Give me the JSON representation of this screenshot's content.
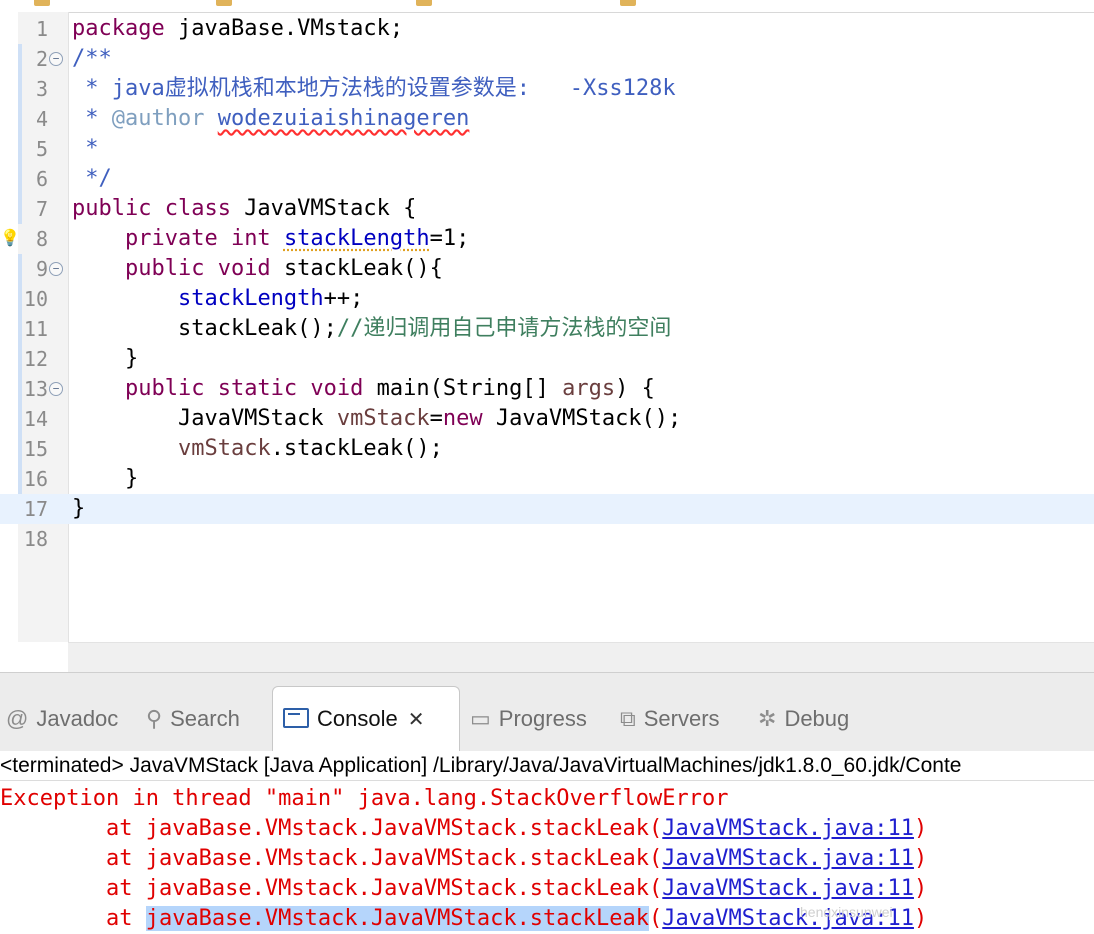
{
  "editor": {
    "lines": [
      {
        "n": "1",
        "segs": [
          {
            "c": "kw",
            "t": "package "
          },
          {
            "c": "",
            "t": "javaBase.VMstack;"
          }
        ]
      },
      {
        "n": "2",
        "fold": true,
        "segs": [
          {
            "c": "jd",
            "t": "/**"
          }
        ]
      },
      {
        "n": "3",
        "segs": [
          {
            "c": "jd",
            "t": " * java虚拟机栈和本地方法栈的设置参数是:   -Xss128k"
          }
        ]
      },
      {
        "n": "4",
        "segs": [
          {
            "c": "jd",
            "t": " * "
          },
          {
            "c": "tag",
            "t": "@author"
          },
          {
            "c": "jd",
            "t": " "
          },
          {
            "c": "spell",
            "t": "wodezuiaishinageren"
          }
        ]
      },
      {
        "n": "5",
        "segs": [
          {
            "c": "jd",
            "t": " *"
          }
        ]
      },
      {
        "n": "6",
        "segs": [
          {
            "c": "jd",
            "t": " */"
          }
        ]
      },
      {
        "n": "7",
        "segs": [
          {
            "c": "kw",
            "t": "public class "
          },
          {
            "c": "",
            "t": "JavaVMStack {"
          }
        ]
      },
      {
        "n": "8",
        "warn": true,
        "segs": [
          {
            "c": "",
            "t": "    "
          },
          {
            "c": "kw",
            "t": "private int "
          },
          {
            "c": "fld-warn",
            "t": "stackLength"
          },
          {
            "c": "",
            "t": "=1;"
          }
        ]
      },
      {
        "n": "9",
        "fold": true,
        "segs": [
          {
            "c": "",
            "t": "    "
          },
          {
            "c": "kw",
            "t": "public void "
          },
          {
            "c": "",
            "t": "stackLeak(){"
          }
        ]
      },
      {
        "n": "10",
        "segs": [
          {
            "c": "",
            "t": "        "
          },
          {
            "c": "fld",
            "t": "stackLength"
          },
          {
            "c": "",
            "t": "++;"
          }
        ]
      },
      {
        "n": "11",
        "segs": [
          {
            "c": "",
            "t": "        stackLeak();"
          },
          {
            "c": "cm",
            "t": "//递归调用自己申请方法栈的空间"
          }
        ]
      },
      {
        "n": "12",
        "segs": [
          {
            "c": "",
            "t": "    }"
          }
        ]
      },
      {
        "n": "13",
        "fold": true,
        "segs": [
          {
            "c": "",
            "t": "    "
          },
          {
            "c": "kw",
            "t": "public static void "
          },
          {
            "c": "",
            "t": "main(String[] "
          },
          {
            "c": "lv",
            "t": "args"
          },
          {
            "c": "",
            "t": ") {"
          }
        ]
      },
      {
        "n": "14",
        "segs": [
          {
            "c": "",
            "t": "        JavaVMStack "
          },
          {
            "c": "lv",
            "t": "vmStack"
          },
          {
            "c": "",
            "t": "="
          },
          {
            "c": "kw",
            "t": "new "
          },
          {
            "c": "",
            "t": "JavaVMStack();"
          }
        ]
      },
      {
        "n": "15",
        "segs": [
          {
            "c": "",
            "t": "        "
          },
          {
            "c": "lv",
            "t": "vmStack"
          },
          {
            "c": "",
            "t": ".stackLeak();"
          }
        ]
      },
      {
        "n": "16",
        "segs": [
          {
            "c": "",
            "t": "    }"
          }
        ]
      },
      {
        "n": "17",
        "current": true,
        "segs": [
          {
            "c": "",
            "t": "}"
          }
        ]
      },
      {
        "n": "18",
        "segs": []
      }
    ]
  },
  "views": {
    "tabs": [
      {
        "label": "Javadoc",
        "icon": "@",
        "icon_name": "at-icon"
      },
      {
        "label": "Search",
        "icon": "⚲",
        "icon_name": "flashlight-icon"
      },
      {
        "label": "Console",
        "active": true,
        "icon_name": "console-icon"
      },
      {
        "label": "Progress",
        "icon": "▭",
        "icon_name": "progress-icon"
      },
      {
        "label": "Servers",
        "icon": "⧉",
        "icon_name": "servers-icon"
      },
      {
        "label": "Debug",
        "icon": "✲",
        "icon_name": "bug-icon"
      }
    ],
    "close_glyph": "✕"
  },
  "console": {
    "status": "<terminated> JavaVMStack [Java Application] /Library/Java/JavaVirtualMachines/jdk1.8.0_60.jdk/Conte",
    "exception": "Exception in thread \"main\" java.lang.StackOverflowError",
    "frames": [
      {
        "prefix": "        at ",
        "method": "javaBase.VMstack.JavaVMStack.stackLeak",
        "link": "JavaVMStack.java:11"
      },
      {
        "prefix": "        at ",
        "method": "javaBase.VMstack.JavaVMStack.stackLeak",
        "link": "JavaVMStack.java:11"
      },
      {
        "prefix": "        at ",
        "method": "javaBase.VMstack.JavaVMStack.stackLeak",
        "link": "JavaVMStack.java:11"
      },
      {
        "prefix": "        at ",
        "method": "javaBase.VMstack.JavaVMStack.stackLeak",
        "link": "JavaVMStack.java:11",
        "selected": true
      }
    ],
    "watermark": "henqxinsunwei"
  },
  "colors": {
    "error": "#e00000",
    "link": "#1f1fcf",
    "keyword": "#7f0055",
    "javadoc": "#3f5fbf",
    "comment": "#3f7f5f"
  }
}
